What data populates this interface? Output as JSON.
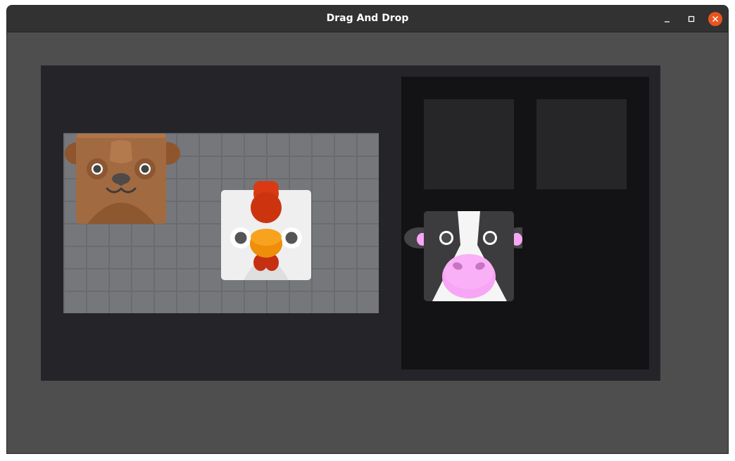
{
  "window": {
    "title": "Drag And Drop"
  },
  "colors": {
    "titlebar": "#333233",
    "window_bg": "#4e4e4e",
    "container_bg": "#252428",
    "grid_bg": "#76777a",
    "dropzone_bg": "#131315",
    "slot_bg": "#262629",
    "close_button": "#e9541f"
  },
  "draggables": [
    {
      "name": "bear",
      "icon": "bear-icon",
      "location": "grid"
    },
    {
      "name": "chicken",
      "icon": "chicken-icon",
      "location": "grid"
    },
    {
      "name": "cow",
      "icon": "cow-icon",
      "location": "drop-zone"
    }
  ],
  "drop_zone": {
    "slots": [
      {
        "filled": false
      },
      {
        "filled": false
      }
    ]
  }
}
